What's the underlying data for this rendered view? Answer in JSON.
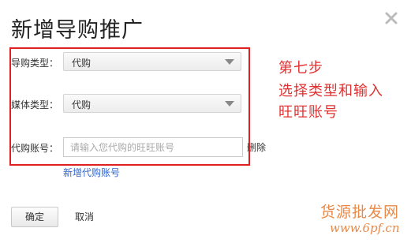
{
  "dialog": {
    "title": "新增导购推广"
  },
  "form": {
    "guide_type": {
      "label": "导购类型：",
      "value": "代购"
    },
    "media_type": {
      "label": "媒体类型：",
      "value": "代购"
    },
    "account": {
      "label": "代购账号：",
      "placeholder": "请输入您代购的旺旺账号",
      "value": ""
    },
    "delete_label": "删除",
    "add_account_label": "新增代购账号"
  },
  "annotation": {
    "line1": "第七步",
    "line2": "选择类型和输入",
    "line3": "旺旺账号",
    "color": "#e23030"
  },
  "footer": {
    "confirm_label": "确定",
    "cancel_label": "取消"
  },
  "watermark": {
    "site_name": "货源批发网",
    "url": "www.6pf.cn"
  },
  "colors": {
    "link": "#3366cc",
    "highlight": "#e02020",
    "watermark": "#e88a4a"
  }
}
